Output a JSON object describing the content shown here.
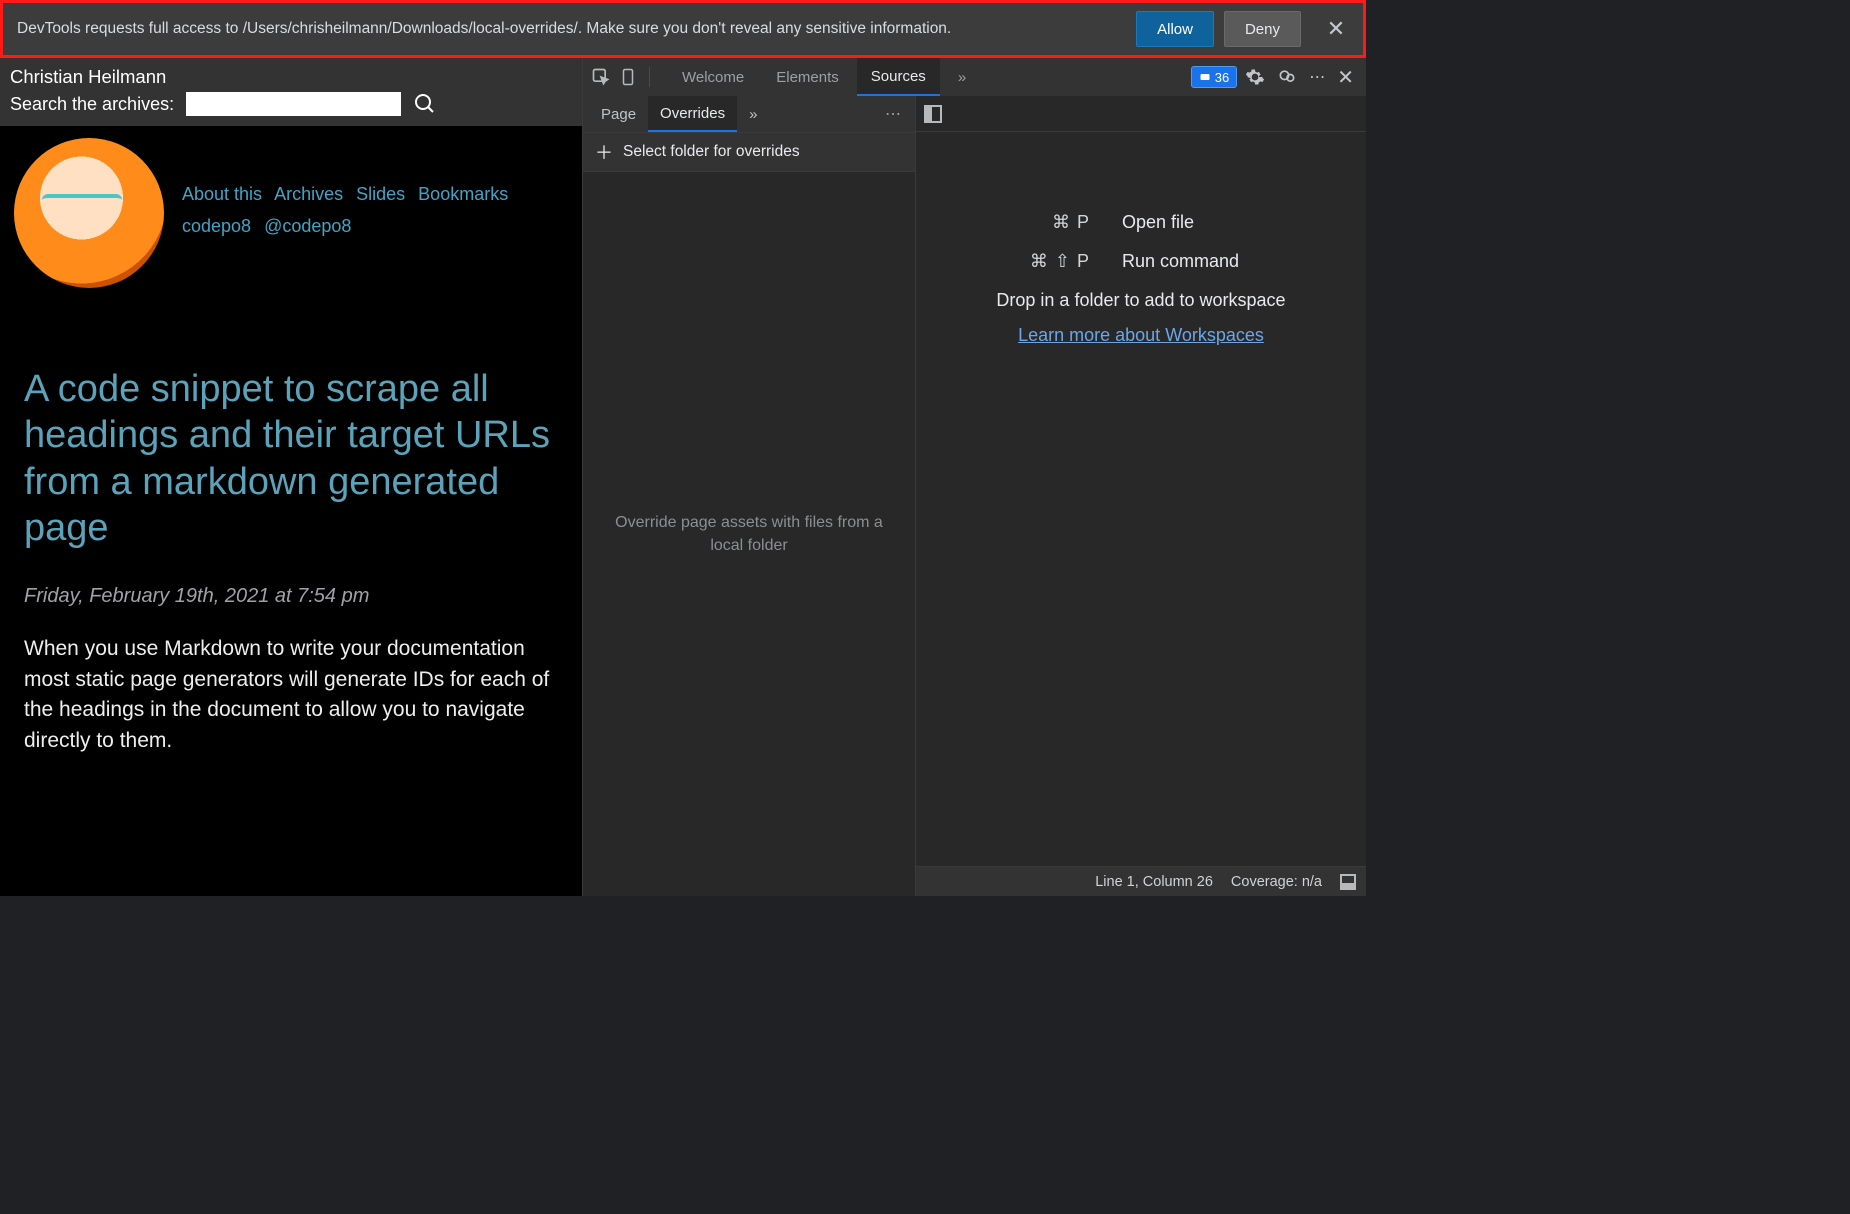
{
  "notification": {
    "message": "DevTools requests full access to /Users/chrisheilmann/Downloads/local-overrides/. Make sure you don't reveal any sensitive information.",
    "allow_label": "Allow",
    "deny_label": "Deny"
  },
  "site": {
    "author_name": "Christian Heilmann",
    "search_label": "Search the archives:",
    "nav": {
      "about": "About this",
      "archives": "Archives",
      "slides": "Slides",
      "bookmarks": "Bookmarks",
      "codepo8": "codepo8",
      "at_codepo8": "@codepo8"
    },
    "article": {
      "title": "A code snippet to scrape all headings and their target URLs from a markdown generated page",
      "date": "Friday, February 19th, 2021 at 7:54 pm",
      "body_intro": "When you use Markdown to write your documentation most static page generators will generate IDs for each of the headings in the document to allow you to navigate directly to them."
    }
  },
  "devtools": {
    "main_tabs": [
      "Welcome",
      "Elements",
      "Sources"
    ],
    "active_main_tab": "Sources",
    "issue_count": "36",
    "nav_tabs": [
      "Page",
      "Overrides"
    ],
    "active_nav_tab": "Overrides",
    "select_folder_label": "Select folder for overrides",
    "empty_nav_hint": "Override page assets with files from a local folder",
    "hints": {
      "open_file_keys": "⌘ P",
      "open_file_label": "Open file",
      "run_cmd_keys": "⌘ ⇧ P",
      "run_cmd_label": "Run command",
      "drop_text": "Drop in a folder to add to workspace",
      "workspace_link": "Learn more about Workspaces"
    },
    "status": {
      "cursor": "Line 1, Column 26",
      "coverage": "Coverage: n/a"
    }
  }
}
